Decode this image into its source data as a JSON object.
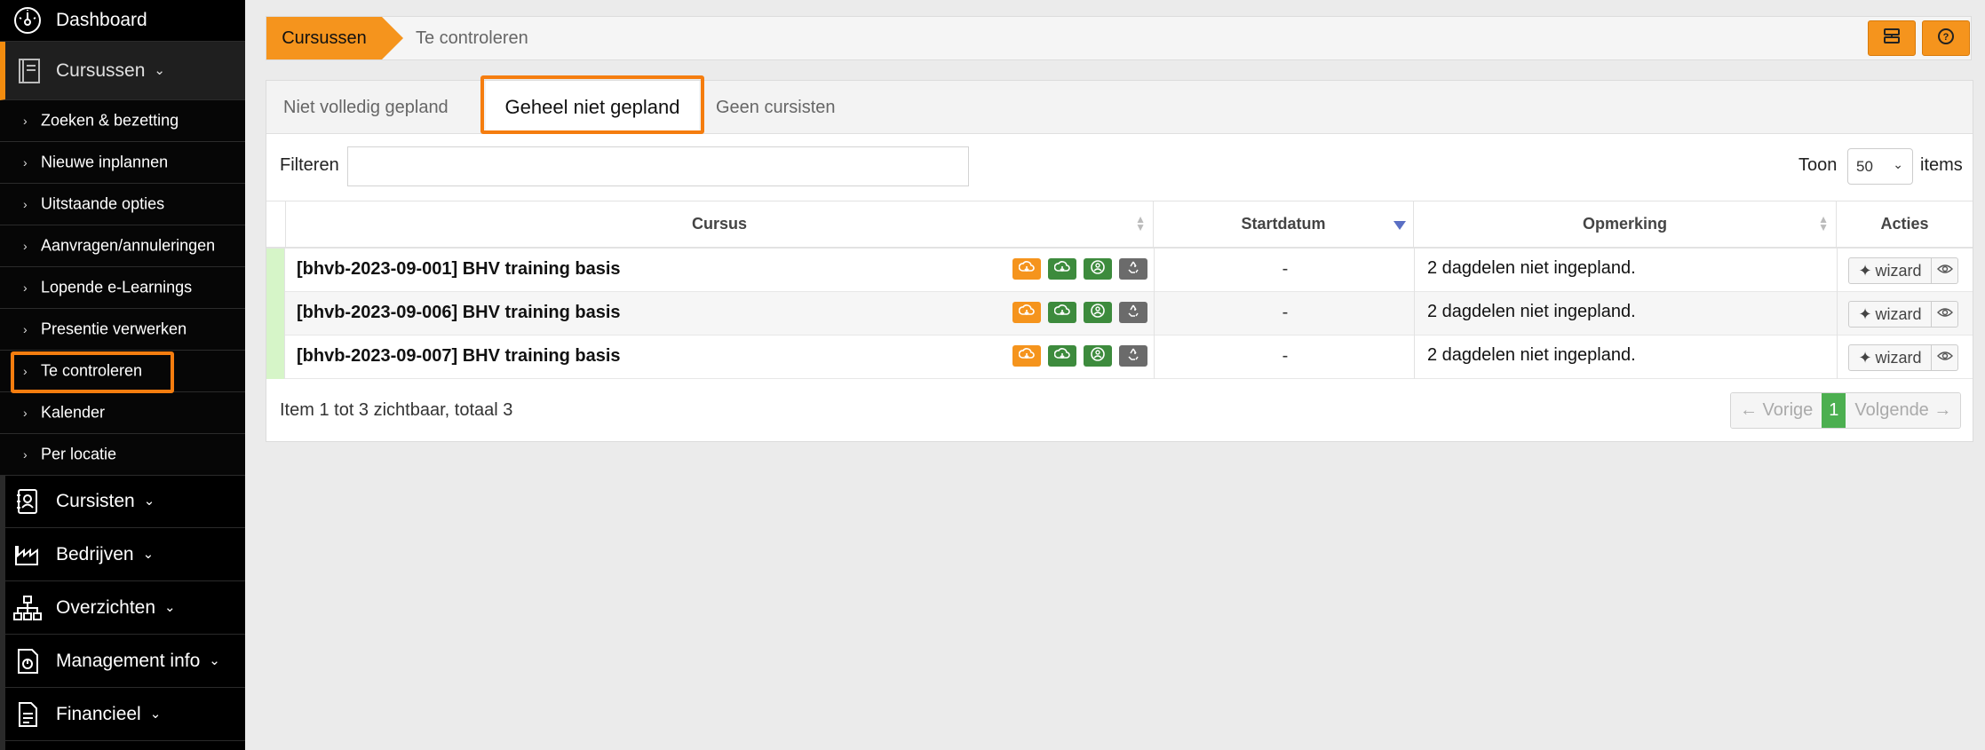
{
  "sidebar": {
    "main_top": [
      {
        "label": "Dashboard",
        "icon": "dashboard-icon"
      },
      {
        "label": "Cursussen",
        "icon": "book-icon"
      }
    ],
    "sub_items": [
      "Zoeken & bezetting",
      "Nieuwe inplannen",
      "Uitstaande opties",
      "Aanvragen/annuleringen",
      "Lopende e-Learnings",
      "Presentie verwerken",
      "Te controleren",
      "Kalender",
      "Per locatie"
    ],
    "main_bottom": [
      {
        "label": "Cursisten",
        "icon": "contact-book-icon"
      },
      {
        "label": "Bedrijven",
        "icon": "factory-icon"
      },
      {
        "label": "Overzichten",
        "icon": "sitemap-icon"
      },
      {
        "label": "Management info",
        "icon": "report-icon"
      },
      {
        "label": "Financieel",
        "icon": "document-icon"
      }
    ]
  },
  "breadcrumb": {
    "root": "Cursussen",
    "current": "Te controleren"
  },
  "tabs": [
    {
      "label": "Niet volledig gepland"
    },
    {
      "label": "Geheel niet gepland"
    },
    {
      "label": "Geen cursisten"
    }
  ],
  "filter": {
    "label": "Filteren",
    "value": "",
    "toon_label": "Toon",
    "page_size": "50",
    "items_label": "items"
  },
  "table": {
    "columns": [
      "Cursus",
      "Startdatum",
      "Opmerking",
      "Acties"
    ],
    "rows": [
      {
        "cursus": "[bhvb-2023-09-001] BHV training basis",
        "startdatum": "-",
        "opmerking": "2 dagdelen niet ingepland.",
        "wizard": "wizard"
      },
      {
        "cursus": "[bhvb-2023-09-006] BHV training basis",
        "startdatum": "-",
        "opmerking": "2 dagdelen niet ingepland.",
        "wizard": "wizard"
      },
      {
        "cursus": "[bhvb-2023-09-007] BHV training basis",
        "startdatum": "-",
        "opmerking": "2 dagdelen niet ingepland.",
        "wizard": "wizard"
      }
    ]
  },
  "summary": "Item 1 tot 3 zichtbaar, totaal 3",
  "pager": {
    "prev": "← Vorige",
    "current": "1",
    "next": "Volgende →"
  },
  "colors": {
    "accent": "#f5941d",
    "highlight": "#f57d0f",
    "green": "#3d8b3d",
    "row_strip": "#d6f5c8"
  }
}
